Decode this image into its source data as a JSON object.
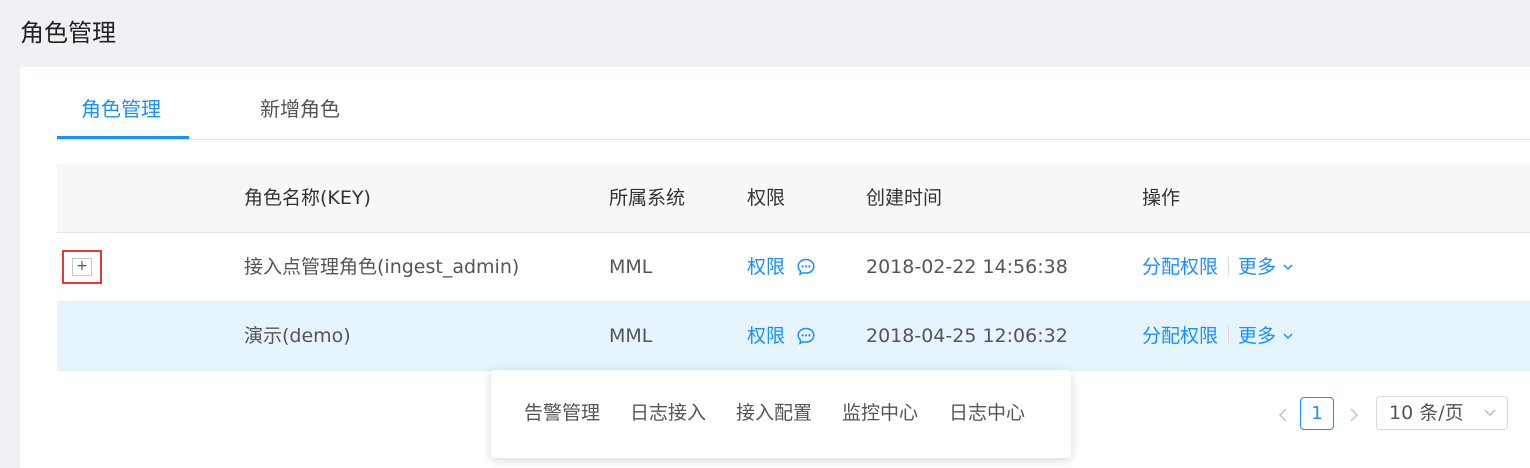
{
  "page": {
    "title": "角色管理"
  },
  "tabs": [
    {
      "label": "角色管理",
      "active": true
    },
    {
      "label": "新增角色",
      "active": false
    }
  ],
  "table": {
    "headers": {
      "name": "角色名称(KEY)",
      "system": "所属系统",
      "permission": "权限",
      "created": "创建时间",
      "actions": "操作"
    },
    "rows": [
      {
        "name": "接入点管理角色(ingest_admin)",
        "system": "MML",
        "permission": "权限",
        "created": "2018-02-22 14:56:38",
        "assign": "分配权限",
        "more": "更多",
        "expand_symbol": "+"
      },
      {
        "name": "演示(demo)",
        "system": "MML",
        "permission": "权限",
        "created": "2018-04-25 12:06:32",
        "assign": "分配权限",
        "more": "更多"
      }
    ]
  },
  "popover": {
    "items": [
      "告警管理",
      "日志接入",
      "接入配置",
      "监控中心",
      "日志中心"
    ]
  },
  "pagination": {
    "current_page": "1",
    "page_size": "10 条/页"
  },
  "colors": {
    "accent": "#1890ff",
    "selected_row": "#e6f5fd",
    "highlight_border": "#e53935",
    "page_bg": "#f0f1f4"
  },
  "icons": {
    "permission": "chat-bubble-icon",
    "more": "chevron-down-icon",
    "prev": "chevron-left-icon",
    "next": "chevron-right-icon"
  }
}
